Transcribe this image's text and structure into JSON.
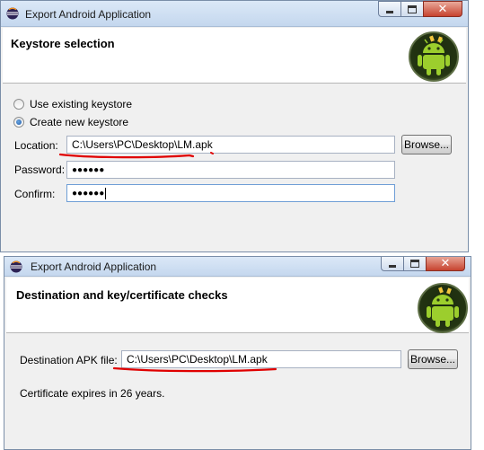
{
  "colors": {
    "window_border": "#7a8ea8",
    "annotation_red": "#e00000",
    "titlebar": "#c4d7ee"
  },
  "window1": {
    "title": "Export Android Application",
    "header_title": "Keystore selection",
    "radio_use_existing": "Use existing keystore",
    "radio_create_new": "Create new keystore",
    "selected_option": "Create new keystore",
    "location_label": "Location:",
    "location_value": "C:\\Users\\PC\\Desktop\\LM.apk",
    "browse_label": "Browse...",
    "password_label": "Password:",
    "password_value": "●●●●●●",
    "confirm_label": "Confirm:",
    "confirm_value": "●●●●●●"
  },
  "window2": {
    "title": "Export Android Application",
    "header_title": "Destination and key/certificate checks",
    "dest_label": "Destination APK file:",
    "dest_value": "C:\\Users\\PC\\Desktop\\LM.apk",
    "browse_label": "Browse...",
    "cert_text": "Certificate expires in 26 years."
  },
  "icons": [
    "eclipse-app-icon",
    "minimize-icon",
    "maximize-icon",
    "close-icon",
    "android-logo-icon"
  ]
}
